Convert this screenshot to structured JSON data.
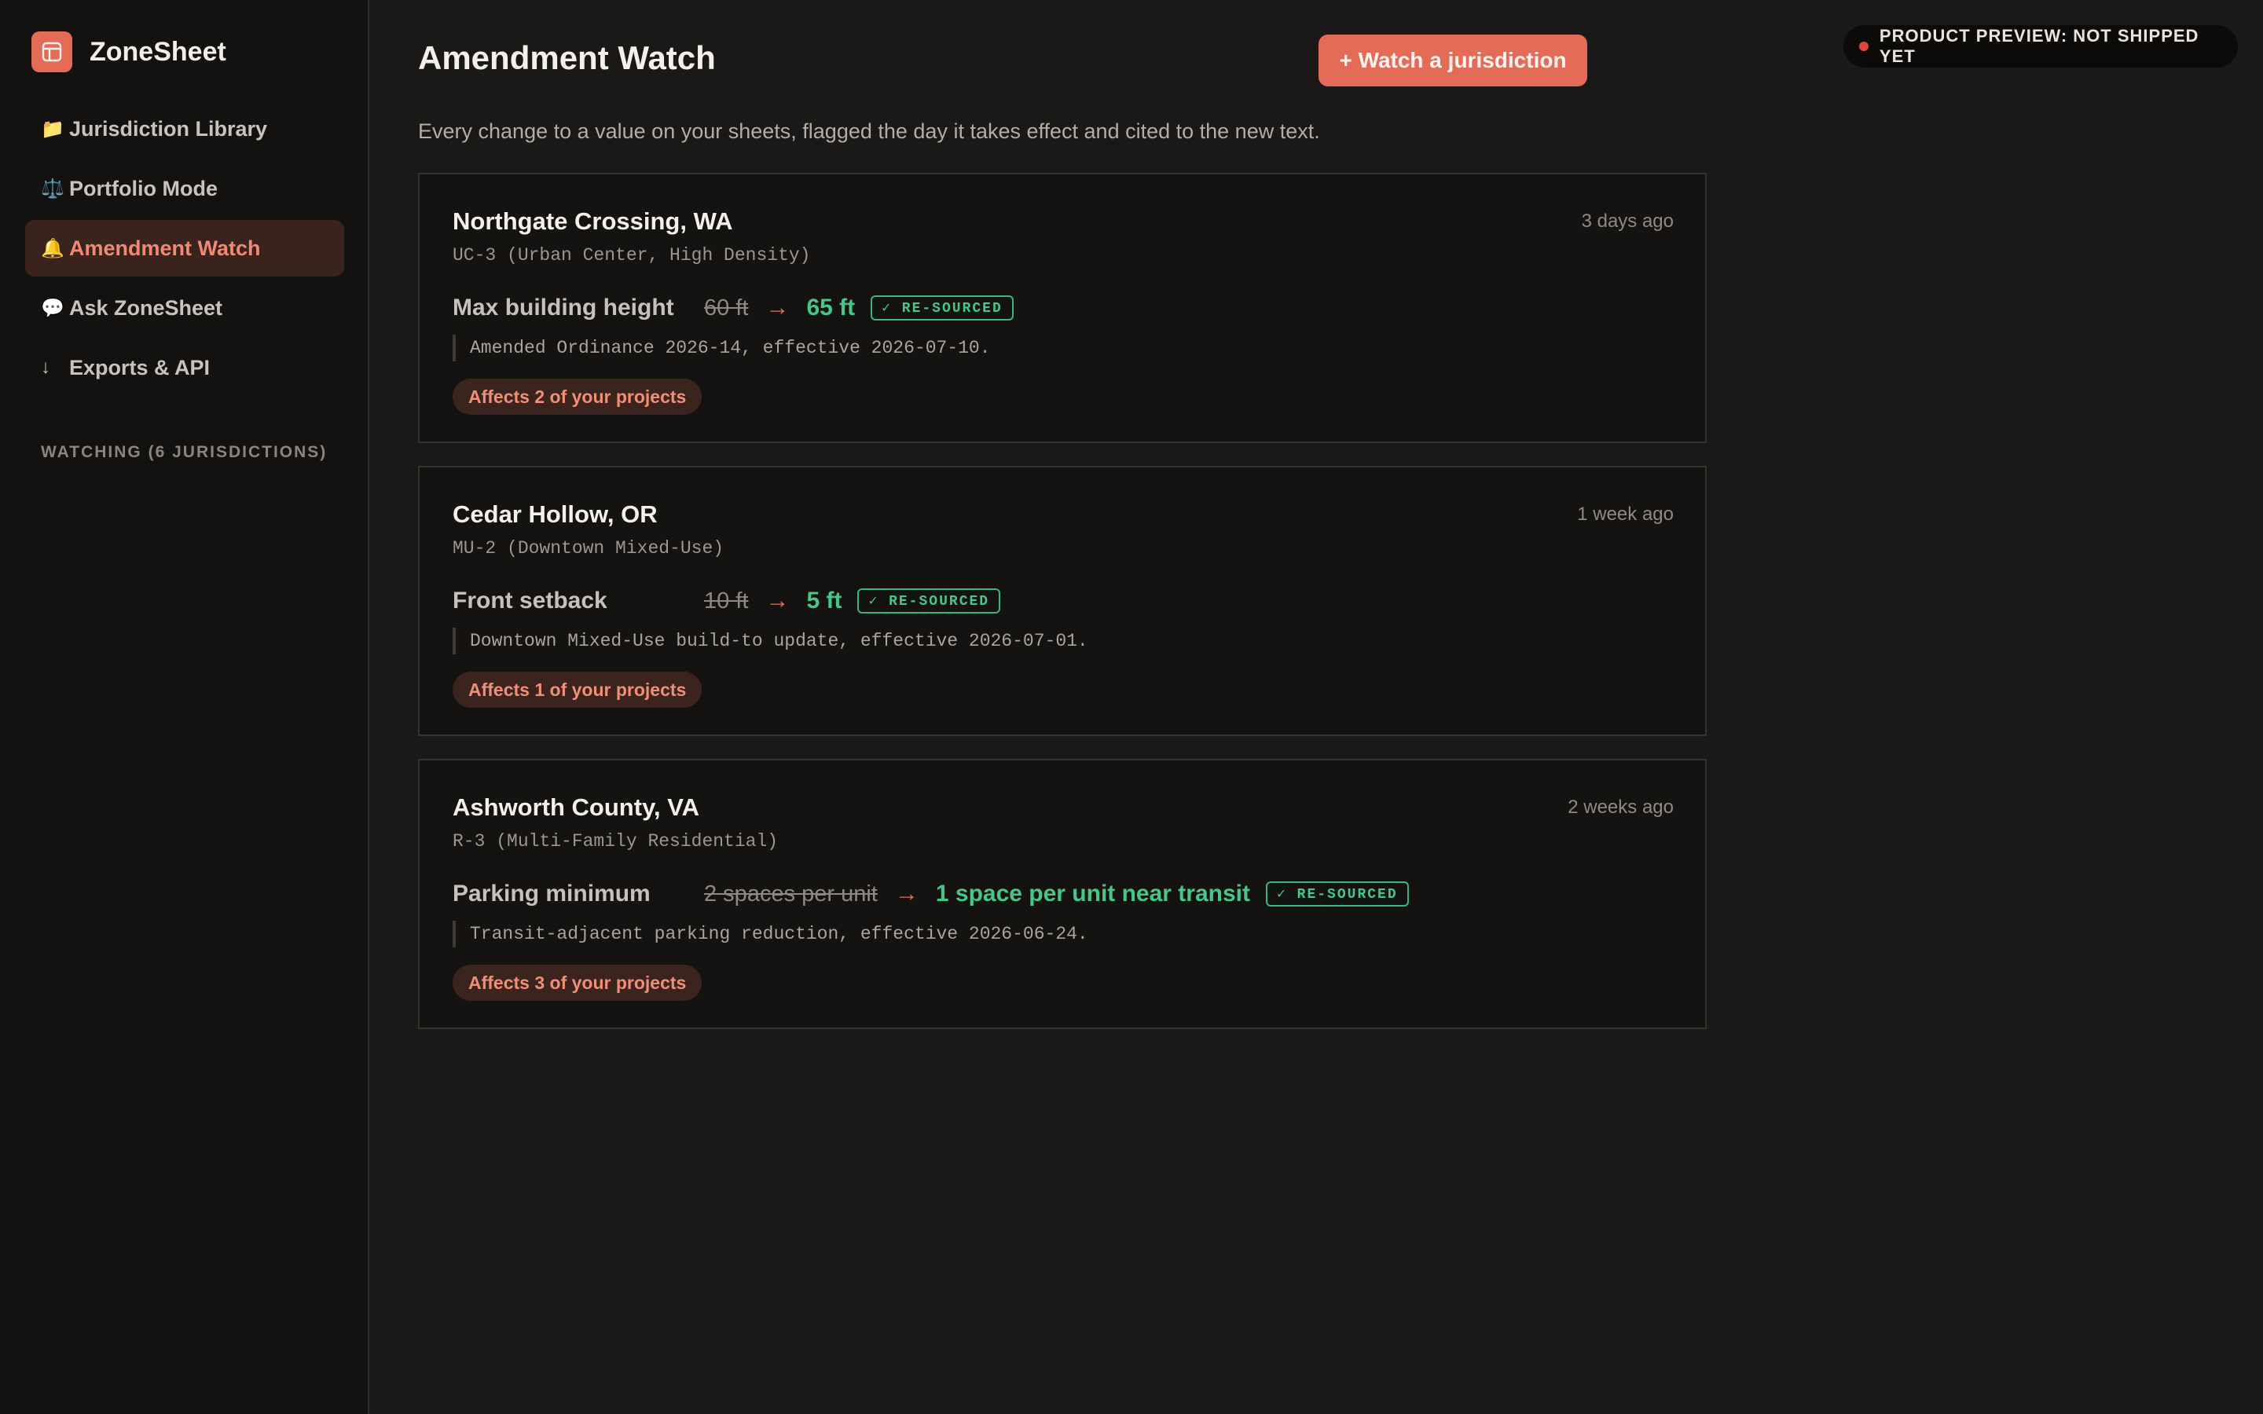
{
  "app": {
    "name": "ZoneSheet"
  },
  "sidebar": {
    "items": [
      {
        "emoji": "📁",
        "label": "Jurisdiction Library",
        "active": false
      },
      {
        "emoji": "⚖️",
        "label": "Portfolio Mode",
        "active": false
      },
      {
        "emoji": "🔔",
        "label": "Amendment Watch",
        "active": true
      },
      {
        "emoji": "💬",
        "label": "Ask ZoneSheet",
        "active": false
      },
      {
        "emoji": "↓",
        "label": "Exports & API",
        "active": false
      }
    ],
    "section_label": "WATCHING (6 JURISDICTIONS)"
  },
  "header": {
    "title": "Amendment Watch",
    "watch_button": "+ Watch a jurisdiction",
    "preview_badge": "PRODUCT PREVIEW: NOT SHIPPED YET",
    "subtitle": "Every change to a value on your sheets, flagged the day it takes effect and cited to the new text."
  },
  "cards": [
    {
      "title": "Northgate Crossing, WA",
      "time": "3 days ago",
      "zone": "UC-3 (Urban Center, High Density)",
      "label": "Max building height",
      "old": "60 ft",
      "arrow": "→",
      "new": "65 ft",
      "badge": "✓ RE-SOURCED",
      "citation": "Amended Ordinance 2026-14, effective 2026-07-10.",
      "affects": "Affects 2 of your projects"
    },
    {
      "title": "Cedar Hollow, OR",
      "time": "1 week ago",
      "zone": "MU-2 (Downtown Mixed-Use)",
      "label": "Front setback",
      "old": "10 ft",
      "arrow": "→",
      "new": "5 ft",
      "badge": "✓ RE-SOURCED",
      "citation": "Downtown Mixed-Use build-to update, effective 2026-07-01.",
      "affects": "Affects 1 of your projects"
    },
    {
      "title": "Ashworth County, VA",
      "time": "2 weeks ago",
      "zone": "R-3 (Multi-Family Residential)",
      "label": "Parking minimum",
      "old": "2 spaces per unit",
      "arrow": "→",
      "new": "1 space per unit near transit",
      "badge": "✓ RE-SOURCED",
      "citation": "Transit-adjacent parking reduction, effective 2026-06-24.",
      "affects": "Affects 3 of your projects"
    }
  ],
  "colors": {
    "accent": "#e46b57",
    "success": "#46c689",
    "background": "#1a1917",
    "sidebar": "#131210"
  }
}
